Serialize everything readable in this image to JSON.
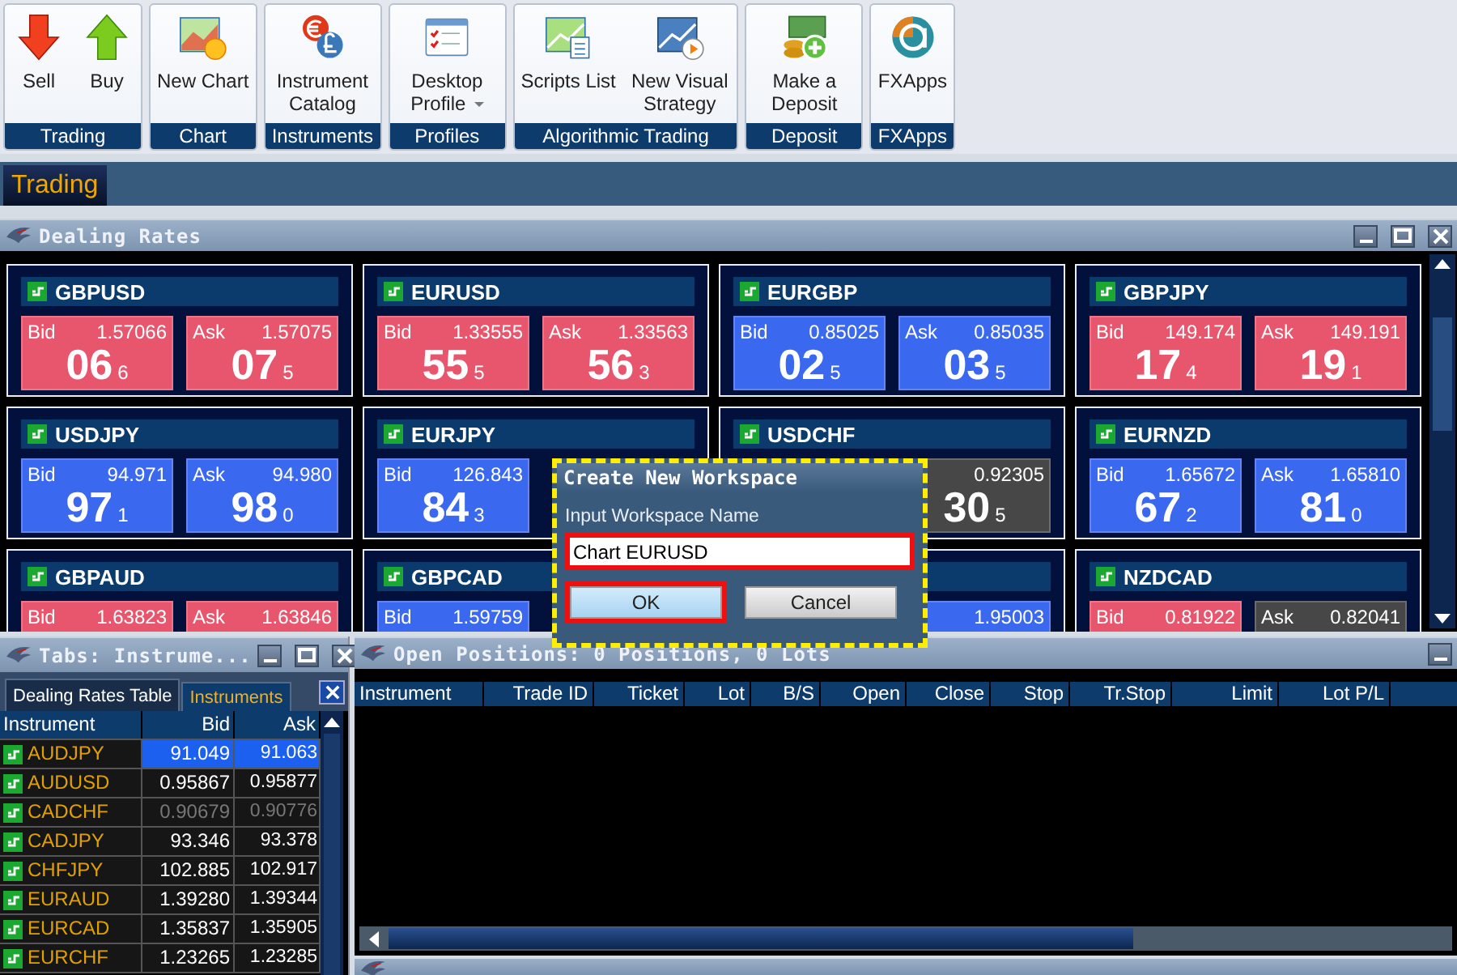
{
  "ribbon": {
    "groups": [
      {
        "label": "Trading",
        "buttons": [
          {
            "label": "Sell",
            "dropdown": false
          },
          {
            "label": "Buy",
            "dropdown": false
          }
        ]
      },
      {
        "label": "Chart",
        "buttons": [
          {
            "label": "New Chart",
            "dropdown": false
          }
        ]
      },
      {
        "label": "Instruments",
        "buttons": [
          {
            "label": "Instrument Catalog",
            "dropdown": false
          }
        ]
      },
      {
        "label": "Profiles",
        "buttons": [
          {
            "label": "Desktop Profile",
            "dropdown": true
          }
        ]
      },
      {
        "label": "Algorithmic Trading",
        "buttons": [
          {
            "label": "Scripts List",
            "dropdown": false
          },
          {
            "label": "New Visual Strategy",
            "dropdown": false
          }
        ]
      },
      {
        "label": "Deposit",
        "buttons": [
          {
            "label": "Make a Deposit",
            "dropdown": false
          }
        ]
      },
      {
        "label": "FXApps",
        "buttons": [
          {
            "label": "FXApps",
            "dropdown": false
          }
        ]
      }
    ]
  },
  "tabs": [
    {
      "label": "Trading",
      "selected": true
    }
  ],
  "dealing_rates": {
    "title": "Dealing Rates",
    "cards": [
      {
        "pair": "GBPUSD",
        "bid": {
          "label": "Bid",
          "price": "1.57066",
          "big": "06",
          "pip": "6",
          "color": "#e8566e"
        },
        "ask": {
          "label": "Ask",
          "price": "1.57075",
          "big": "07",
          "pip": "5",
          "color": "#e8566e"
        }
      },
      {
        "pair": "EURUSD",
        "bid": {
          "label": "Bid",
          "price": "1.33555",
          "big": "55",
          "pip": "5",
          "color": "#e8566e"
        },
        "ask": {
          "label": "Ask",
          "price": "1.33563",
          "big": "56",
          "pip": "3",
          "color": "#e8566e"
        }
      },
      {
        "pair": "EURGBP",
        "bid": {
          "label": "Bid",
          "price": "0.85025",
          "big": "02",
          "pip": "5",
          "color": "#3a68ee"
        },
        "ask": {
          "label": "Ask",
          "price": "0.85035",
          "big": "03",
          "pip": "5",
          "color": "#3a68ee"
        }
      },
      {
        "pair": "GBPJPY",
        "bid": {
          "label": "Bid",
          "price": "149.174",
          "big": "17",
          "pip": "4",
          "color": "#e8566e"
        },
        "ask": {
          "label": "Ask",
          "price": "149.191",
          "big": "19",
          "pip": "1",
          "color": "#e8566e"
        }
      },
      {
        "pair": "USDJPY",
        "bid": {
          "label": "Bid",
          "price": "94.971",
          "big": "97",
          "pip": "1",
          "color": "#3a68ee"
        },
        "ask": {
          "label": "Ask",
          "price": "94.980",
          "big": "98",
          "pip": "0",
          "color": "#3a68ee"
        }
      },
      {
        "pair": "EURJPY",
        "bid": {
          "label": "Bid",
          "price": "126.843",
          "big": "84",
          "pip": "3",
          "color": "#3a68ee"
        }
      },
      {
        "pair": "USDCHF",
        "ask": {
          "price": "0.92305",
          "big": "30",
          "pip": "5",
          "color": "#474747"
        }
      },
      {
        "pair": "EURNZD",
        "bid": {
          "label": "Bid",
          "price": "1.65672",
          "big": "67",
          "pip": "2",
          "color": "#3a68ee"
        },
        "ask": {
          "label": "Ask",
          "price": "1.65810",
          "big": "81",
          "pip": "0",
          "color": "#3a68ee"
        }
      },
      {
        "pair": "GBPAUD",
        "bid": {
          "label": "Bid",
          "price": "1.63823",
          "color": "#e8566e"
        },
        "ask": {
          "label": "Ask",
          "price": "1.63846",
          "color": "#e8566e"
        }
      },
      {
        "pair": "GBPCAD",
        "bid": {
          "label": "Bid",
          "price": "1.59759",
          "color": "#3a68ee"
        }
      },
      {
        "ask": {
          "price": "1.95003",
          "color": "#3a68ee"
        }
      },
      {
        "pair": "NZDCAD",
        "bid": {
          "label": "Bid",
          "price": "0.81922",
          "color": "#e8566e"
        },
        "ask": {
          "label": "Ask",
          "price": "0.82041",
          "color": "#474747"
        }
      }
    ]
  },
  "instruments_panel": {
    "title": "Tabs: Instrume...",
    "tabs": [
      {
        "label": "Dealing Rates Table",
        "selected": false
      },
      {
        "label": "Instruments",
        "selected": true
      }
    ],
    "columns": [
      "Instrument",
      "Bid",
      "Ask"
    ],
    "rows": [
      {
        "instrument": "AUDJPY",
        "bid": "91.049",
        "ask": "91.063",
        "selected": true,
        "disabled": false
      },
      {
        "instrument": "AUDUSD",
        "bid": "0.95867",
        "ask": "0.95877",
        "selected": false,
        "disabled": false
      },
      {
        "instrument": "CADCHF",
        "bid": "0.90679",
        "ask": "0.90776",
        "selected": false,
        "disabled": true
      },
      {
        "instrument": "CADJPY",
        "bid": "93.346",
        "ask": "93.378",
        "selected": false,
        "disabled": false
      },
      {
        "instrument": "CHFJPY",
        "bid": "102.885",
        "ask": "102.917",
        "selected": false,
        "disabled": false
      },
      {
        "instrument": "EURAUD",
        "bid": "1.39280",
        "ask": "1.39344",
        "selected": false,
        "disabled": false
      },
      {
        "instrument": "EURCAD",
        "bid": "1.35837",
        "ask": "1.35905",
        "selected": false,
        "disabled": false
      },
      {
        "instrument": "EURCHF",
        "bid": "1.23265",
        "ask": "1.23285",
        "selected": false,
        "disabled": false
      }
    ]
  },
  "open_positions": {
    "title": "Open Positions: 0 Positions, 0 Lots",
    "columns": [
      "Instrument",
      "Trade ID",
      "Ticket",
      "Lot",
      "B/S",
      "Open",
      "Close",
      "Stop",
      "Tr.Stop",
      "Limit",
      "Lot P/L"
    ]
  },
  "dialog": {
    "title": "Create New Workspace",
    "outlined": true,
    "label": "Input Workspace Name",
    "value": "Chart EURUSD",
    "value_highlighted": true,
    "buttons": [
      {
        "label": "OK",
        "highlighted": true
      },
      {
        "label": "Cancel",
        "highlighted": false
      }
    ]
  }
}
